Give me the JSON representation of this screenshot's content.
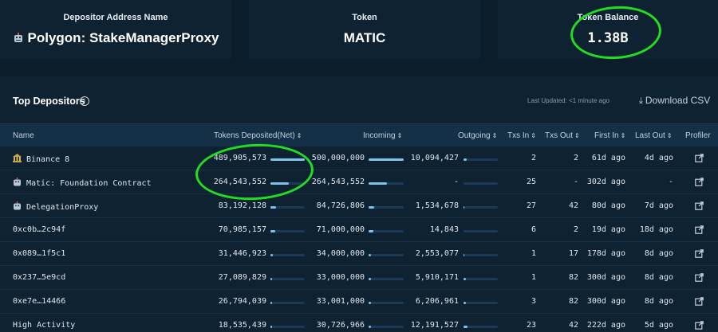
{
  "cards": {
    "depositor_label": "Depositor Address Name",
    "depositor_value": "Polygon: StakeManagerProxy",
    "token_label": "Token",
    "token_value": "MATIC",
    "balance_label": "Token Balance",
    "balance_value": "1.38B"
  },
  "panel": {
    "title": "Top Depositors",
    "updated": "Last Updated: <1 minute ago",
    "download": "Download CSV"
  },
  "columns": {
    "name": "Name",
    "deposited": "Tokens Deposited(Net)",
    "incoming": "Incoming",
    "outgoing": "Outgoing",
    "txs_in": "Txs In",
    "txs_out": "Txs Out",
    "first_in": "First In",
    "last_out": "Last Out",
    "profiler": "Profiler"
  },
  "rows": [
    {
      "name": "Binance 8",
      "deposited": "489,905,573",
      "dep_frac": 1.0,
      "incoming": "500,000,000",
      "in_frac": 1.0,
      "outgoing": "10,094,427",
      "out_frac": 0.1,
      "txs_in": "2",
      "txs_out": "2",
      "first_in": "61d ago",
      "last_out": "4d ago"
    },
    {
      "name": "Matic: Foundation Contract",
      "deposited": "264,543,552",
      "dep_frac": 0.54,
      "incoming": "264,543,552",
      "in_frac": 0.53,
      "outgoing": "-",
      "out_frac": 0,
      "txs_in": "25",
      "txs_out": "-",
      "first_in": "302d ago",
      "last_out": "-"
    },
    {
      "name": "DelegationProxy",
      "deposited": "83,192,128",
      "dep_frac": 0.17,
      "incoming": "84,726,806",
      "in_frac": 0.17,
      "outgoing": "1,534,678",
      "out_frac": 0.02,
      "txs_in": "27",
      "txs_out": "42",
      "first_in": "80d ago",
      "last_out": "7d ago"
    },
    {
      "name": "0xc0b…2c94f",
      "deposited": "70,985,157",
      "dep_frac": 0.14,
      "incoming": "71,000,000",
      "in_frac": 0.14,
      "outgoing": "14,843",
      "out_frac": 0.0,
      "txs_in": "6",
      "txs_out": "2",
      "first_in": "19d ago",
      "last_out": "18d ago"
    },
    {
      "name": "0x089…1f5c1",
      "deposited": "31,446,923",
      "dep_frac": 0.06,
      "incoming": "34,000,000",
      "in_frac": 0.07,
      "outgoing": "2,553,077",
      "out_frac": 0.03,
      "txs_in": "1",
      "txs_out": "17",
      "first_in": "178d ago",
      "last_out": "8d ago"
    },
    {
      "name": "0x237…5e9cd",
      "deposited": "27,089,829",
      "dep_frac": 0.055,
      "incoming": "33,000,000",
      "in_frac": 0.066,
      "outgoing": "5,910,171",
      "out_frac": 0.06,
      "txs_in": "1",
      "txs_out": "82",
      "first_in": "300d ago",
      "last_out": "8d ago"
    },
    {
      "name": "0xe7e…14466",
      "deposited": "26,794,039",
      "dep_frac": 0.055,
      "incoming": "33,001,000",
      "in_frac": 0.066,
      "outgoing": "6,206,961",
      "out_frac": 0.06,
      "txs_in": "3",
      "txs_out": "82",
      "first_in": "300d ago",
      "last_out": "8d ago"
    },
    {
      "name": "High Activity",
      "deposited": "18,535,439",
      "dep_frac": 0.04,
      "incoming": "30,726,966",
      "in_frac": 0.06,
      "outgoing": "12,191,527",
      "out_frac": 0.12,
      "txs_in": "23",
      "txs_out": "42",
      "first_in": "222d ago",
      "last_out": "5d ago"
    }
  ],
  "annotations": {
    "color": "#22dd22"
  },
  "colors": {
    "bar_fill": "#7cc4ea",
    "bar_track": "#1c3a55",
    "background": "#0b1d2b",
    "panel": "#0f2232"
  }
}
